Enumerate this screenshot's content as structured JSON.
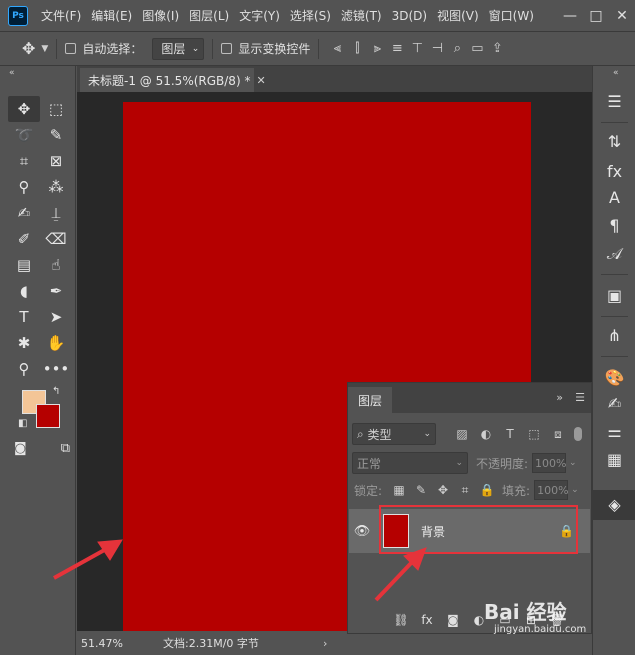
{
  "app": {
    "logo": "Ps"
  },
  "menubar": {
    "items": [
      "文件(F)",
      "编辑(E)",
      "图像(I)",
      "图层(L)",
      "文字(Y)",
      "选择(S)",
      "滤镜(T)",
      "3D(D)",
      "视图(V)",
      "窗口(W)"
    ],
    "window_controls": {
      "minimize": "—",
      "maximize": "□",
      "close": "✕"
    }
  },
  "options_bar": {
    "auto_select_label": "自动选择：",
    "auto_select_target": "图层",
    "show_transform_label": "显示变换控件"
  },
  "document": {
    "tab_title": "未标题-1 @ 51.5%(RGB/8) *",
    "canvas_color": "#b50000"
  },
  "status_bar": {
    "zoom": "51.47%",
    "doc_info": "文档:2.31M/0 字节"
  },
  "swatches": {
    "foreground": "#f3c597",
    "background": "#b50000"
  },
  "layers_panel": {
    "tab_label": "图层",
    "filter_kind": "类型",
    "blend_mode": "正常",
    "opacity_label": "不透明度:",
    "opacity_value": "100%",
    "lock_label": "锁定:",
    "fill_label": "填充:",
    "fill_value": "100%",
    "layers": [
      {
        "name": "背景",
        "visible": true,
        "locked": true
      }
    ]
  },
  "annotation_color": "#e5333a",
  "watermark": {
    "brand": "Bai 经验",
    "url": "jingyan.baidu.com"
  }
}
